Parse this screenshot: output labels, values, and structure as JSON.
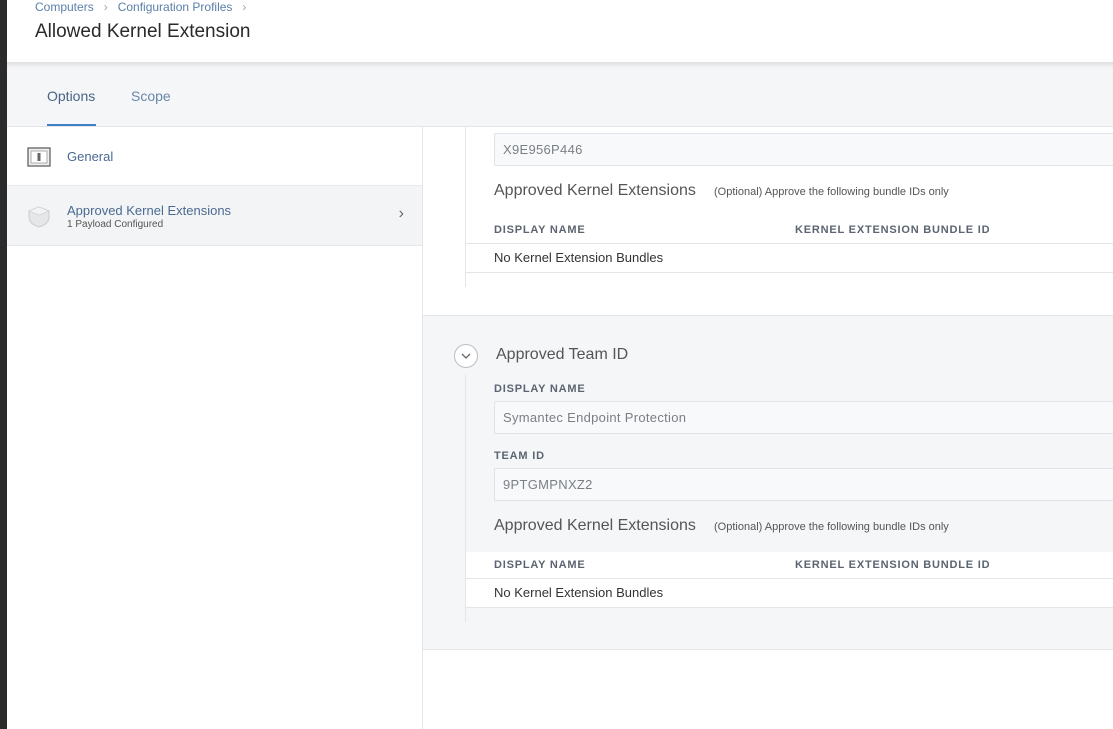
{
  "breadcrumb": [
    "Computers",
    "Configuration Profiles"
  ],
  "page_title": "Allowed Kernel Extension",
  "tabs": [
    {
      "label": "Options",
      "active": true
    },
    {
      "label": "Scope",
      "active": false
    }
  ],
  "sidebar": {
    "items": [
      {
        "label": "General",
        "icon": "switch-icon"
      },
      {
        "label": "Approved Kernel Extensions",
        "sub": "1 Payload Configured",
        "icon": "shield-icon"
      }
    ]
  },
  "team1": {
    "team_id_value": "X9E956P446",
    "extensions_title": "Approved Kernel Extensions",
    "extensions_optional": "(Optional) Approve the following bundle IDs only",
    "col_display_name": "DISPLAY NAME",
    "col_bundle_id": "KERNEL EXTENSION BUNDLE ID",
    "empty_text": "No Kernel Extension Bundles"
  },
  "team2": {
    "title": "Approved Team ID",
    "display_name_label": "DISPLAY NAME",
    "display_name_value": "Symantec Endpoint Protection",
    "team_id_label": "TEAM ID",
    "team_id_value": "9PTGMPNXZ2",
    "extensions_title": "Approved Kernel Extensions",
    "extensions_optional": "(Optional) Approve the following bundle IDs only",
    "col_display_name": "DISPLAY NAME",
    "col_bundle_id": "KERNEL EXTENSION BUNDLE ID",
    "empty_text": "No Kernel Extension Bundles"
  },
  "colors": {
    "accent": "#3f7fc7",
    "link": "#5a7fa8",
    "panel_gray": "#f5f6f8"
  }
}
